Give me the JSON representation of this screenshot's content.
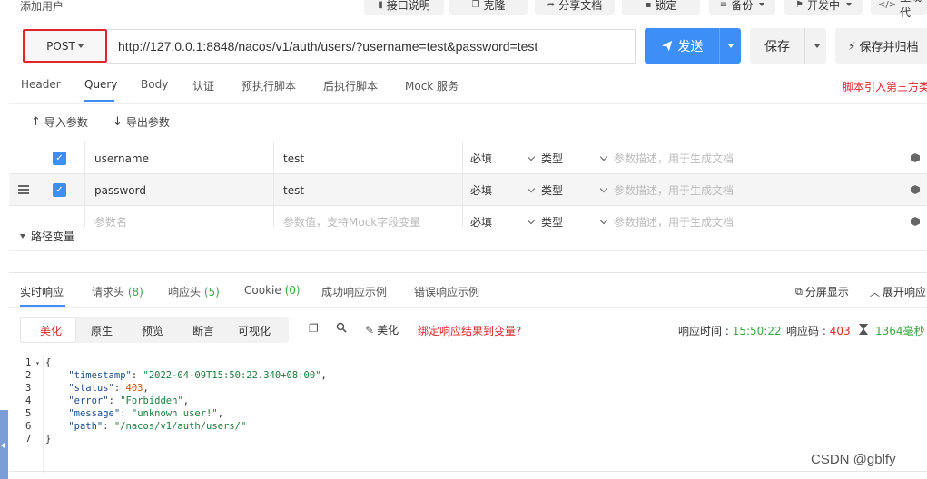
{
  "page_title": "添加用户",
  "toolbar": {
    "doc_label": "接口说明",
    "clone_label": "克隆",
    "share_label": "分享文档",
    "lock_label": "锁定",
    "backup_label": "备份",
    "dev_label": "开发中",
    "gen_label": "生成代"
  },
  "request": {
    "method": "POST",
    "url": "http://127.0.0.1:8848/nacos/v1/auth/users/?username=test&password=test",
    "send_label": "发送",
    "save_label": "保存",
    "save_archive_label": "保存并归档"
  },
  "request_tabs": [
    {
      "label": "Header"
    },
    {
      "label": "Query"
    },
    {
      "label": "Body"
    },
    {
      "label": "认证"
    },
    {
      "label": "预执行脚本"
    },
    {
      "label": "后执行脚本"
    },
    {
      "label": "Mock 服务"
    }
  ],
  "script_note": "脚本引入第三方类",
  "import_label": "导入参数",
  "export_label": "导出参数",
  "params": [
    {
      "name": "username",
      "value": "test",
      "required": "必填",
      "type": "类型",
      "desc_placeholder": "参数描述，用于生成文档"
    },
    {
      "name": "password",
      "value": "test",
      "required": "必填",
      "type": "类型",
      "desc_placeholder": "参数描述，用于生成文档"
    }
  ],
  "new_param": {
    "name_placeholder": "参数名",
    "value_placeholder": "参数值，支持Mock字段变量",
    "required": "必填",
    "type": "类型",
    "desc_placeholder": "参数描述，用于生成文档"
  },
  "path_vars_label": "路径变量",
  "response_tabs": {
    "realtime": "实时响应",
    "req_headers": "请求头",
    "req_headers_count": "(8)",
    "resp_headers": "响应头",
    "resp_headers_count": "(5)",
    "cookie": "Cookie",
    "cookie_count": "(0)",
    "success_example": "成功响应示例",
    "error_example": "错误响应示例"
  },
  "split_label": "分屏显示",
  "expand_label": "展开响应",
  "view_modes": {
    "pretty": "美化",
    "raw": "原生",
    "preview": "预览",
    "assert": "断言",
    "visualize": "可视化"
  },
  "beautify_label": "美化",
  "bind_label": "绑定响应结果到变量?",
  "response_meta": {
    "time_label": "响应时间 : ",
    "time_value": "15:50:22",
    "code_label": "响应码 : ",
    "code_value": "403",
    "duration": "1364毫秒"
  },
  "response_body": {
    "timestamp": "2022-04-09T15:50:22.340+08:00",
    "status": "403",
    "error": "Forbidden",
    "message": "unknown user!",
    "path": "/nacos/v1/auth/users/"
  },
  "line_numbers": [
    "1",
    "2",
    "3",
    "4",
    "5",
    "6",
    "7"
  ],
  "watermark": "CSDN @gblfy"
}
